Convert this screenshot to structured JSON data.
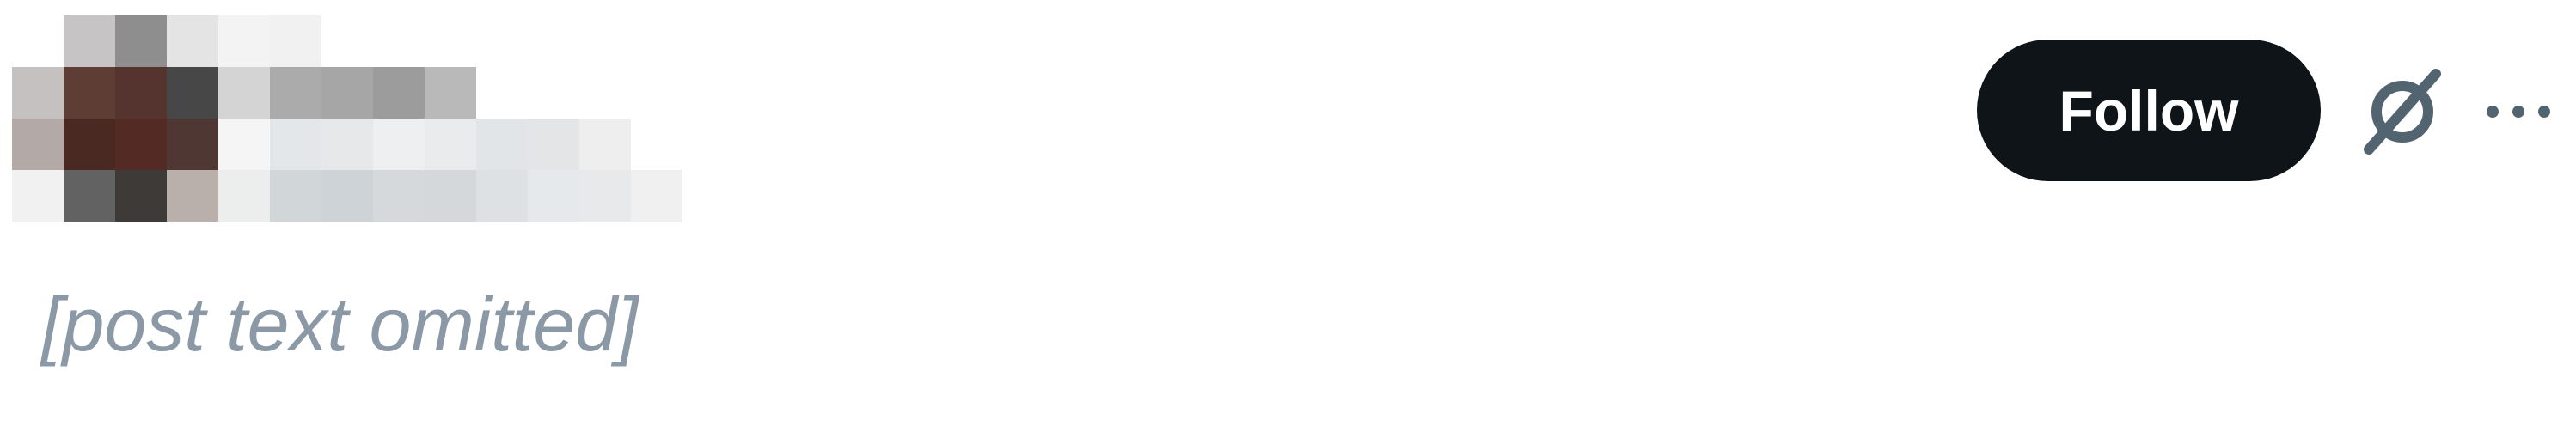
{
  "colors": {
    "text": "#0f1419",
    "button_bg": "#0f1419",
    "button_text": "#ffffff",
    "icon": "#536471",
    "placeholder_text": "#8b98a5"
  },
  "post": {
    "follow_label": "Follow",
    "text": "",
    "text_placeholder": "[post text omitted]",
    "author_icon": "grok-icon",
    "menu_icon": "more-icon"
  },
  "redacted_header": {
    "rows": [
      [
        "",
        "#c6c4c4",
        "#8e8e8e",
        "#e4e4e4",
        "#f3f3f3",
        "#f1f1f1",
        "",
        "",
        "",
        "",
        "",
        "",
        ""
      ],
      [
        "#c5c1c1",
        "#5e3d35",
        "#55342f",
        "#474747",
        "#d4d4d4",
        "#ababab",
        "#a6a6a6",
        "#9c9c9c",
        "#b9b9b9",
        "",
        "",
        "",
        ""
      ],
      [
        "#b3a9a6",
        "#4a2923",
        "#532a24",
        "#4f3833",
        "#f5f5f5",
        "#e4e7e9",
        "#e6e8ea",
        "#eeeff0",
        "#e9ebec",
        "#e2e5e7",
        "#e3e5e7",
        "#eeeeef",
        ""
      ],
      [
        "#f1f1f1",
        "#626262",
        "#3e3a38",
        "#b9b0ab",
        "#eceded",
        "#d1d6d9",
        "#cdd3d6",
        "#d5d9dc",
        "#d4d8db",
        "#dde1e3",
        "#e6e9eb",
        "#e7e9ea",
        "#f0f0f1"
      ]
    ]
  }
}
